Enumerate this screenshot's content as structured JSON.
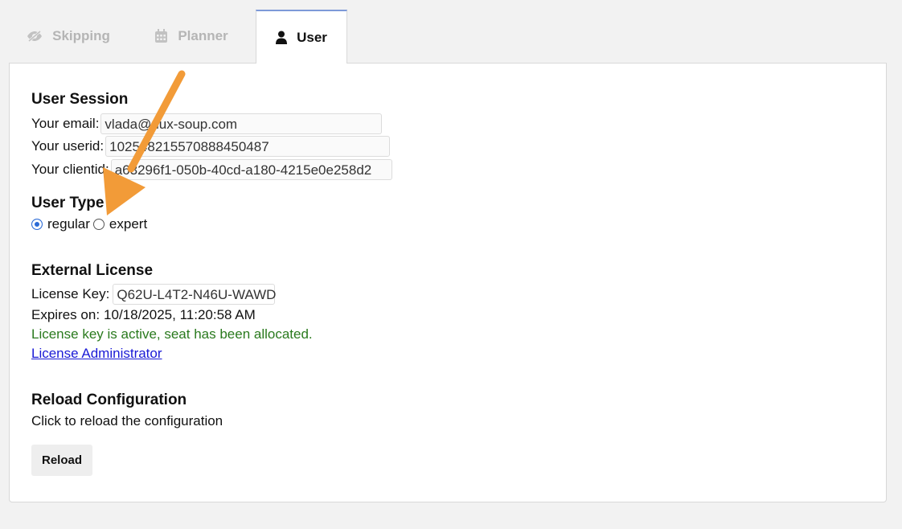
{
  "tabs": [
    {
      "label": "Skipping",
      "icon": "eye-slash-icon"
    },
    {
      "label": "Planner",
      "icon": "calendar-icon"
    },
    {
      "label": "User",
      "icon": "user-icon",
      "active": true
    }
  ],
  "session": {
    "heading": "User Session",
    "email_label": "Your email:",
    "email_value": "vlada@dux-soup.com",
    "userid_label": "Your userid:",
    "userid_value": "102548215570888450487",
    "clientid_label": "Your clientid:",
    "clientid_value": "a63296f1-050b-40cd-a180-4215e0e258d2"
  },
  "user_type": {
    "heading": "User Type",
    "options": [
      {
        "label": "regular",
        "selected": true
      },
      {
        "label": "expert",
        "selected": false
      }
    ]
  },
  "license": {
    "heading": "External License",
    "key_label": "License Key:",
    "key_value": "Q62U-L4T2-N46U-WAWD",
    "expires_label": "Expires on:",
    "expires_value": "10/18/2025, 11:20:58 AM",
    "status": "License key is active, seat has been allocated.",
    "admin_link": "License Administrator"
  },
  "reload": {
    "heading": "Reload Configuration",
    "description": "Click to reload the configuration",
    "button_label": "Reload"
  },
  "colors": {
    "active_tab_border": "#7d9ad8",
    "status_green": "#2a7a1e",
    "link_blue": "#1a1ad6",
    "annotation_arrow": "#f29b38",
    "radio_selected": "#2b6bd6"
  }
}
